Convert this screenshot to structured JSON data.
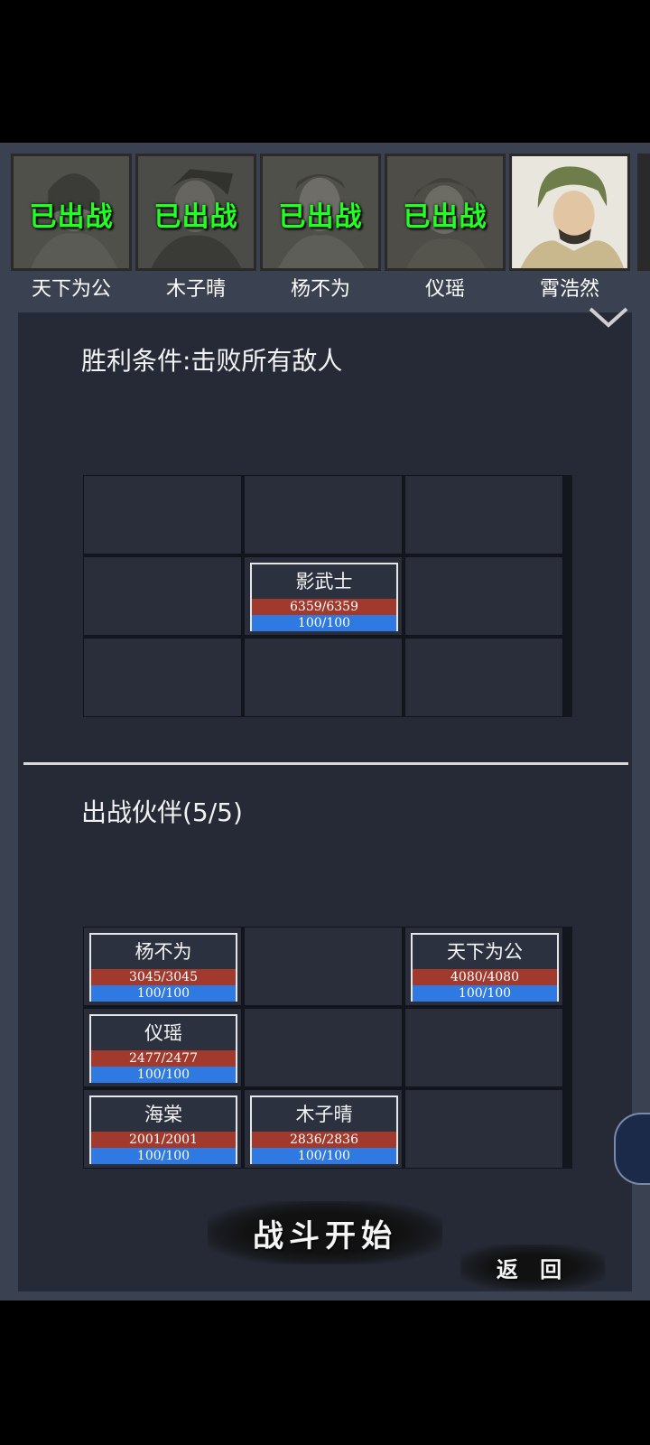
{
  "portraits": [
    {
      "name": "天下为公",
      "badge": "已出战",
      "deployed": true
    },
    {
      "name": "木子晴",
      "badge": "已出战",
      "deployed": true
    },
    {
      "name": "杨不为",
      "badge": "已出战",
      "deployed": true
    },
    {
      "name": "仪瑶",
      "badge": "已出战",
      "deployed": true
    },
    {
      "name": "霄浩然",
      "badge": "",
      "deployed": false
    }
  ],
  "victory_condition": "胜利条件:击败所有敌人",
  "enemy_units": [
    {
      "name": "影武士",
      "hp": "6359/6359",
      "mp": "100/100",
      "row": 2,
      "col": 2
    }
  ],
  "allies_title": "出战伙伴(5/5)",
  "ally_units": [
    {
      "name": "杨不为",
      "hp": "3045/3045",
      "mp": "100/100",
      "row": 1,
      "col": 1
    },
    {
      "name": "天下为公",
      "hp": "4080/4080",
      "mp": "100/100",
      "row": 1,
      "col": 3
    },
    {
      "name": "仪瑶",
      "hp": "2477/2477",
      "mp": "100/100",
      "row": 2,
      "col": 1
    },
    {
      "name": "海棠",
      "hp": "2001/2001",
      "mp": "100/100",
      "row": 3,
      "col": 1
    },
    {
      "name": "木子晴",
      "hp": "2836/2836",
      "mp": "100/100",
      "row": 3,
      "col": 2
    }
  ],
  "buttons": {
    "start": "战斗开始",
    "back": "返 回"
  },
  "colors": {
    "deployed_badge": "#22ff22",
    "hp_bar": "#a13a2c",
    "mp_bar": "#2e7ae2"
  }
}
